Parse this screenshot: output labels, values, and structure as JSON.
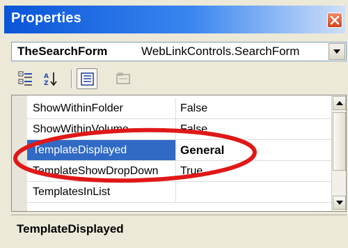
{
  "window": {
    "title": "Properties",
    "close_icon": "close-icon",
    "accent": "#0a55d8"
  },
  "object_selector": {
    "name": "TheSearchForm",
    "type": "WebLinkControls.SearchForm",
    "dropdown_icon": "chevron-down-icon"
  },
  "toolbar": {
    "buttons": [
      {
        "icon": "categorized-icon",
        "pressed": false
      },
      {
        "icon": "alphabetical-icon",
        "pressed": false
      },
      {
        "icon": "properties-icon",
        "pressed": true
      },
      {
        "icon": "property-pages-icon",
        "pressed": false,
        "disabled": true
      }
    ]
  },
  "grid": {
    "rows": [
      {
        "name": "ShowWithinFolder",
        "value": "False"
      },
      {
        "name": "ShowWithinVolume",
        "value": "False"
      },
      {
        "name": "TemplateDisplayed",
        "value": "General",
        "selected": true
      },
      {
        "name": "TemplateShowDropDown",
        "value": "True"
      },
      {
        "name": "TemplatesInList",
        "value": ""
      }
    ],
    "selection_color": "#316ac5"
  },
  "annotation": {
    "color": "#e01818",
    "shape": "ellipse-highlight"
  },
  "description": {
    "title": "TemplateDisplayed"
  }
}
